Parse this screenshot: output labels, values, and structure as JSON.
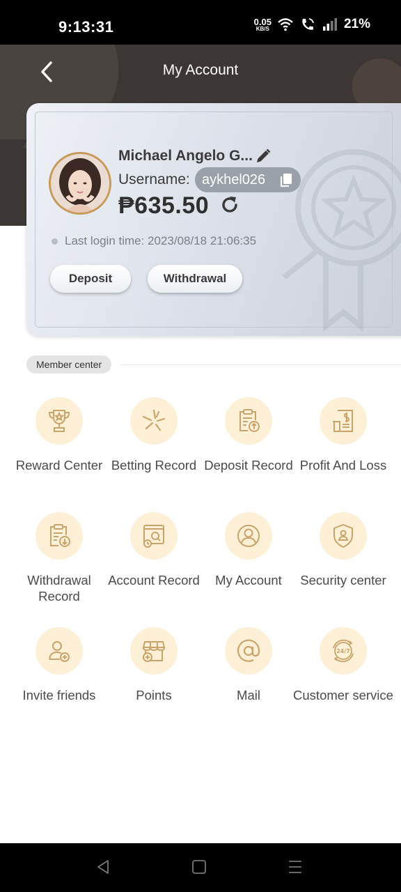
{
  "status_bar": {
    "time": "9:13:31",
    "net_speed_value": "0.05",
    "net_speed_unit": "KB/S",
    "battery": "21%",
    "icons": [
      "wifi-icon",
      "call-icon",
      "signal-icon"
    ]
  },
  "header": {
    "title": "My Account",
    "back_icon": "chevron-left-icon"
  },
  "account_card": {
    "name": "Michael Angelo G...",
    "username_label": "Username:",
    "username": "aykhel026",
    "balance": "₱635.50",
    "last_login": "Last login time: 2023/08/18 21:06:35",
    "deposit_label": "Deposit",
    "withdrawal_label": "Withdrawal"
  },
  "member_center": {
    "title": "Member center",
    "items": [
      {
        "label": "Reward Center",
        "icon": "trophy-icon"
      },
      {
        "label": "Betting Record",
        "icon": "betting-icon"
      },
      {
        "label": "Deposit Record",
        "icon": "deposit-record-icon"
      },
      {
        "label": "Profit And Loss",
        "icon": "profit-loss-icon"
      },
      {
        "label": "Withdrawal Record",
        "icon": "withdrawal-record-icon"
      },
      {
        "label": "Account Record",
        "icon": "account-record-icon"
      },
      {
        "label": "My Account",
        "icon": "user-icon"
      },
      {
        "label": "Security center",
        "icon": "shield-icon"
      },
      {
        "label": "Invite friends",
        "icon": "invite-icon"
      },
      {
        "label": "Points",
        "icon": "points-icon"
      },
      {
        "label": "Mail",
        "icon": "mail-icon"
      },
      {
        "label": "Customer service",
        "icon": "support-24-7-icon"
      }
    ]
  },
  "colors": {
    "header_bg": "#3c3734",
    "icon_bg": "#fdf0d7",
    "icon_stroke": "#c9a46a",
    "text": "#4a4a4a"
  }
}
